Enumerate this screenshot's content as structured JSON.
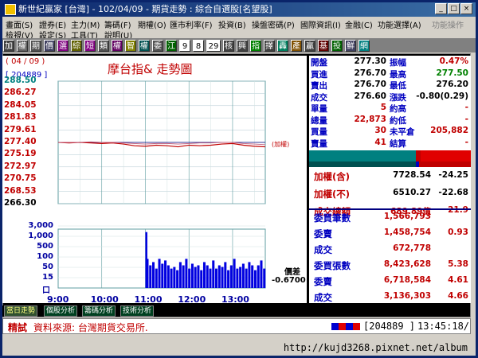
{
  "window": {
    "title": "新世紀贏家 [台灣] - 102/04/09 - 期貨走勢 : 綜合自選股[名望股]"
  },
  "menu": [
    {
      "label": "畫面(S)"
    },
    {
      "label": "證券(E)"
    },
    {
      "label": "主力(M)"
    },
    {
      "label": "籌碼(F)"
    },
    {
      "label": "期權(O)"
    },
    {
      "label": "匯市利率(F)"
    },
    {
      "label": "投資(B)"
    },
    {
      "label": "操盤密碼(P)"
    },
    {
      "label": "國際資訊(I)"
    },
    {
      "label": "金融(C)"
    },
    {
      "label": "功能選擇(A)"
    },
    {
      "label": "功能操作"
    },
    {
      "label": "檢視(V)"
    },
    {
      "label": "設定(S)"
    },
    {
      "label": "工具(T)"
    },
    {
      "label": "說明(U)"
    }
  ],
  "toolbar": [
    "加",
    "權",
    "期",
    "價",
    "選",
    "綜",
    "短",
    "類",
    "權",
    "智",
    "權",
    "委",
    "江",
    "9",
    "8",
    "29",
    "核",
    "興",
    "指",
    "擇",
    "轟",
    "產",
    "贏",
    "基",
    "投",
    "鮮",
    "網"
  ],
  "chart_header": {
    "date": "( 04 / 09 )",
    "code": "[ 204889 ]",
    "title": "摩台指&  走勢圖",
    "ref_label": "(加權)"
  },
  "y_ticks": [
    "288.50",
    "286.27",
    "284.05",
    "281.83",
    "279.61",
    "277.40",
    "275.19",
    "272.97",
    "270.75",
    "268.53",
    "266.30"
  ],
  "vol_ticks": [
    "3,000",
    "1,000",
    "500",
    "100",
    "50",
    "15",
    "口"
  ],
  "x_ticks": [
    "9:00",
    "10:00",
    "11:00",
    "12:00",
    "13:00"
  ],
  "diff": {
    "label": "價差",
    "value": "-0.6700"
  },
  "chart_data": {
    "type": "line",
    "x": [
      "09:00",
      "09:15",
      "09:30",
      "09:45",
      "10:00",
      "10:15",
      "10:30",
      "10:45",
      "11:00",
      "11:15",
      "11:30",
      "11:45",
      "12:00",
      "12:15",
      "12:30",
      "12:45",
      "13:00",
      "13:15",
      "13:30",
      "13:45"
    ],
    "series": [
      {
        "values": [
          277.4,
          277.3,
          277.4,
          277.3,
          277.2,
          277.3,
          277.1,
          276.8,
          276.7,
          276.9,
          276.8,
          276.6,
          276.9,
          276.8,
          276.9,
          277.1,
          277.2,
          276.9,
          276.7,
          276.6
        ]
      },
      {
        "values": [
          277.4,
          277.4,
          277.4,
          277.5,
          277.4,
          277.4,
          277.3,
          277.2,
          277.1,
          277.2,
          277.2,
          277.1,
          277.2,
          277.3,
          277.3,
          277.4,
          277.4,
          277.2,
          277.1,
          277.0
        ]
      }
    ],
    "ylim": [
      266.3,
      288.5
    ],
    "volume_start": "11:00",
    "volume_levels": [
      0.9,
      0.7,
      0.8,
      0.6,
      0.9,
      0.75,
      0.85,
      0.7,
      0.6,
      0.65,
      0.55,
      0.8,
      0.7,
      0.9,
      0.6,
      0.75,
      0.65,
      0.7,
      0.55,
      0.8,
      0.7,
      0.6,
      0.85,
      0.6,
      0.7,
      0.65,
      0.8,
      0.55,
      0.7,
      0.9,
      0.6,
      0.65,
      0.75,
      0.6,
      0.8,
      0.7,
      0.55,
      0.7,
      0.85,
      0.6
    ],
    "volume_peak": 0.95
  },
  "quotes": [
    {
      "l1": "開盤",
      "v1": "277.30",
      "l2": "振幅",
      "v2": "0.47%"
    },
    {
      "l1": "買進",
      "v1": "276.70",
      "l2": "最高",
      "v2": "277.50"
    },
    {
      "l1": "賣出",
      "v1": "276.70",
      "l2": "最低",
      "v2": "276.20"
    },
    {
      "l1": "成交",
      "v1": "276.60",
      "l2": "漲跌",
      "v2": "-0.80(0.29)"
    },
    {
      "l1": "單量",
      "v1": "5",
      "l2": "約高",
      "v2": "-"
    },
    {
      "l1": "總量",
      "v1": "22,873",
      "l2": "約低",
      "v2": "-"
    },
    {
      "l1": "買量",
      "v1": "30",
      "l2": "未平倉",
      "v2": "205,882"
    },
    {
      "l1": "賣量",
      "v1": "41",
      "l2": "結算",
      "v2": "-"
    }
  ],
  "index_rows": [
    {
      "label": "加權(含)",
      "v1": "7728.54",
      "v2": "-24.25"
    },
    {
      "label": "加權(不)",
      "v1": "6510.27",
      "v2": "-22.68"
    },
    {
      "label": "成交總額",
      "v1": "689.89億",
      "v2": "21.9"
    }
  ],
  "order_rows": [
    {
      "label": "委買筆數",
      "v1": "1,566,793",
      "v2": ""
    },
    {
      "label": "委賣",
      "v1": "1,458,754",
      "v2": "0.93"
    },
    {
      "label": "成交",
      "v1": "672,778",
      "v2": ""
    },
    {
      "label": "委買張數",
      "v1": "8,423,628",
      "v2": "5.38"
    },
    {
      "label": "委賣",
      "v1": "6,718,584",
      "v2": "4.61"
    },
    {
      "label": "成交",
      "v1": "3,136,303",
      "v2": "4.66"
    }
  ],
  "tabs": [
    "當日走勢",
    "個股分析",
    "籌碼分析",
    "技術分析"
  ],
  "status": {
    "tag": "精試",
    "source": "資料來源: 台灣期貨交易所.",
    "code": "[204889 ]",
    "time": "13:45:18/"
  },
  "watermark": "http://kujd3268.pixnet.net/album",
  "colors": {
    "up": "#c00000",
    "down": "#008000",
    "label": "#0000c0",
    "price": "#c00000",
    "ref": "#000080"
  }
}
